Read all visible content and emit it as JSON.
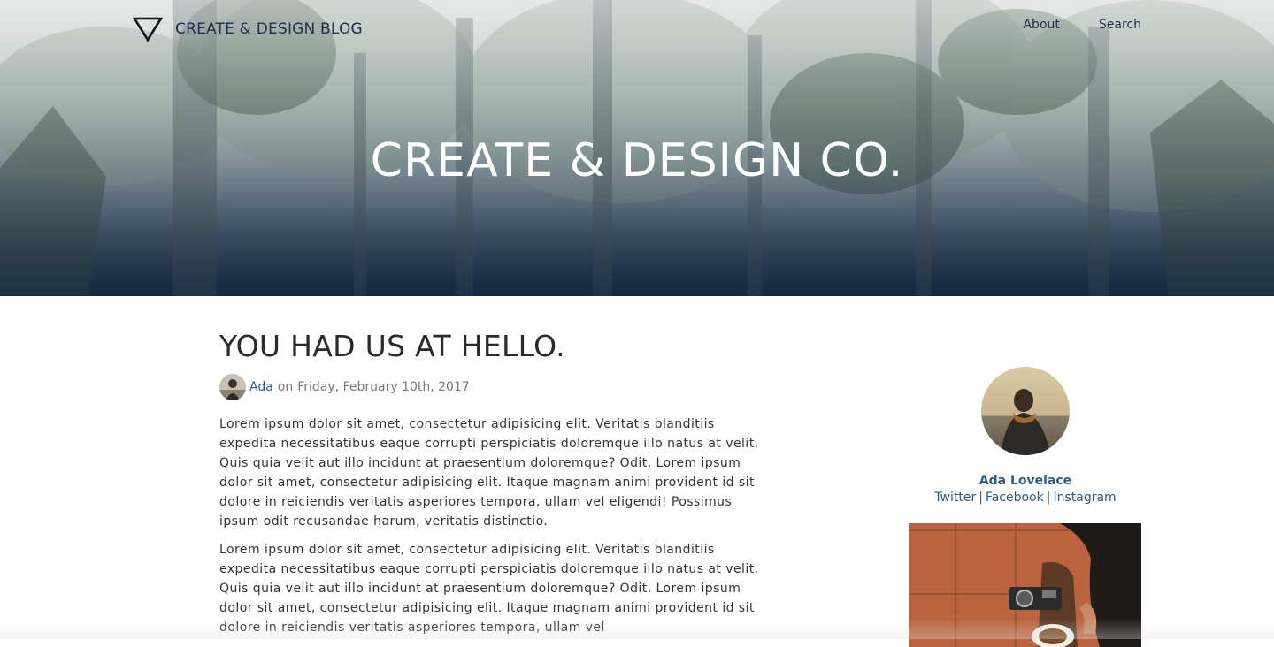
{
  "header": {
    "brand_text": "CREATE & DESIGN BLOG",
    "logo_icon": "triangle-down-icon",
    "nav": [
      {
        "label": "About"
      },
      {
        "label": "Search"
      }
    ],
    "hero_title": "CREATE & DESIGN CO."
  },
  "post": {
    "title": "YOU HAD US AT HELLO.",
    "author": "Ada",
    "on_word": "on",
    "date": "Friday, February 10th, 2017",
    "paragraphs": [
      "Lorem ipsum dolor sit amet, consectetur adipisicing elit. Veritatis blanditiis expedita necessitatibus eaque corrupti perspiciatis doloremque illo natus at velit. Quis quia velit aut illo incidunt at praesentium doloremque? Odit. Lorem ipsum dolor sit amet, consectetur adipisicing elit. Itaque magnam animi provident id sit dolore in reiciendis veritatis asperiores tempora, ullam vel eligendi! Possimus ipsum odit recusandae harum, veritatis distinctio.",
      "Lorem ipsum dolor sit amet, consectetur adipisicing elit. Veritatis blanditiis expedita necessitatibus eaque corrupti perspiciatis doloremque illo natus at velit. Quis quia velit aut illo incidunt at praesentium doloremque? Odit. Lorem ipsum dolor sit amet, consectetur adipisicing elit. Itaque magnam animi provident id sit dolore in reiciendis veritatis asperiores tempora, ullam vel"
    ]
  },
  "sidebar": {
    "author_name": "Ada Lovelace",
    "social": [
      {
        "label": "Twitter"
      },
      {
        "label": "Facebook"
      },
      {
        "label": "Instagram"
      }
    ],
    "separator": "|"
  },
  "colors": {
    "link": "#2b5b87",
    "nav_text": "#1d2f4b",
    "hero_title": "#ffffff",
    "body_text": "#333333"
  }
}
